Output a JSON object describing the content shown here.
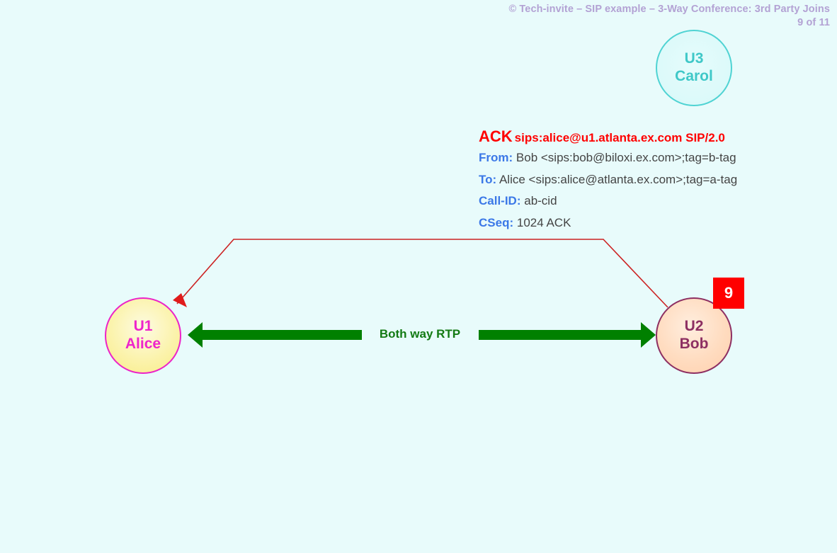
{
  "header": {
    "copyright_line": "© Tech-invite – SIP example – 3-Way Conference: 3rd Party Joins",
    "page_indicator": "9 of 11"
  },
  "colors": {
    "background": "#e8fbfb",
    "header_text": "#b3a2d4",
    "method_red": "#ff0000",
    "header_name_blue": "#3b78e7",
    "header_value_gray": "#444444",
    "rtp_green": "#137a13",
    "badge_red": "#ff0000",
    "alice_magenta": "#ee24cb",
    "bob_plum": "#8d2f62",
    "carol_turquoise": "#3fc8c8",
    "signal_line_red": "#cc2222"
  },
  "actors": [
    {
      "id": "U3",
      "name": "Carol"
    },
    {
      "id": "U1",
      "name": "Alice"
    },
    {
      "id": "U2",
      "name": "Bob"
    }
  ],
  "step_badge": {
    "number": "9"
  },
  "sip_message": {
    "method": "ACK",
    "request_uri": "sips:alice@u1.atlanta.ex.com SIP/2.0",
    "headers": [
      {
        "name": "From",
        "value": " Bob <sips:bob@biloxi.ex.com>;tag=b-tag"
      },
      {
        "name": "To",
        "value": " Alice <sips:alice@atlanta.ex.com>;tag=a-tag"
      },
      {
        "name": "Call-ID",
        "value": " ab-cid"
      },
      {
        "name": "CSeq",
        "value": " 1024 ACK"
      }
    ]
  },
  "media_flow": {
    "label": "Both way RTP"
  }
}
